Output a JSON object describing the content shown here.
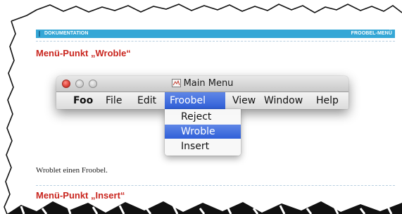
{
  "doc_header": {
    "left_label": "DOKUMENTATION",
    "right_label": "FROOBEL-MENÜ",
    "color": "#35a7d6"
  },
  "sections": [
    {
      "title": "Menü-Punkt „Wroble“"
    },
    {
      "title": "Menü-Punkt „Insert“"
    }
  ],
  "title_color": "#c9251e",
  "window": {
    "title": "Main Menu",
    "app_icon": "document-icon",
    "traffic_lights": [
      "close",
      "minimize",
      "zoom"
    ]
  },
  "menubar": {
    "items": [
      {
        "label": "Foo",
        "bold": true
      },
      {
        "label": "File"
      },
      {
        "label": "Edit"
      },
      {
        "label": "Froobel",
        "active": true
      },
      {
        "label": "View"
      },
      {
        "label": "Window"
      },
      {
        "label": "Help"
      }
    ],
    "highlight_color": "#3d6ad9"
  },
  "dropdown": {
    "items": [
      {
        "label": "Reject"
      },
      {
        "label": "Wroble",
        "selected": true
      },
      {
        "label": "Insert"
      }
    ]
  },
  "body_text": "Wroblet einen Froobel."
}
